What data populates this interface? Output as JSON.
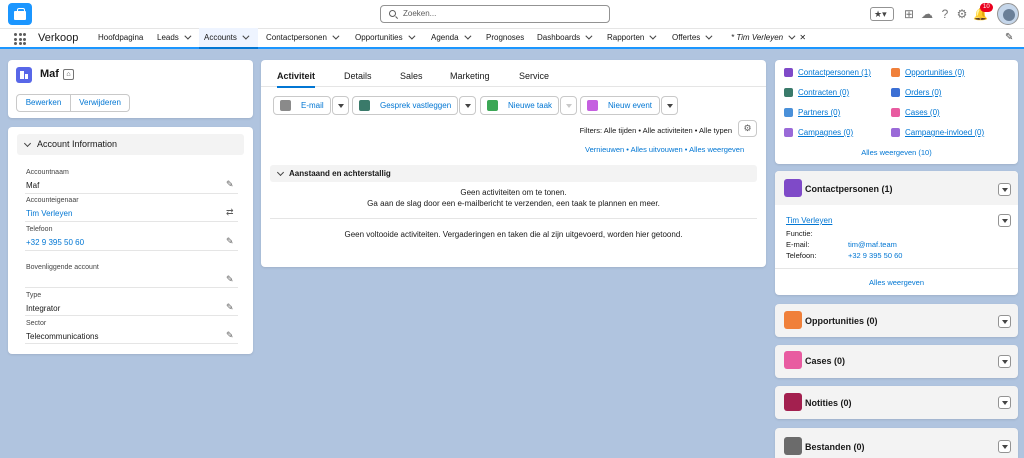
{
  "topbar": {
    "search_placeholder": "Zoeken...",
    "notification_count": "10",
    "icons": [
      "favorites-star-icon",
      "add-icon",
      "trailhead-icon",
      "help-icon",
      "setup-gear-icon",
      "bell-icon",
      "avatar"
    ]
  },
  "nav": {
    "app_name": "Verkoop",
    "items": [
      {
        "label": "Hoofdpagina",
        "dropdown": false
      },
      {
        "label": "Leads",
        "dropdown": true
      },
      {
        "label": "Accounts",
        "dropdown": true,
        "active": true
      },
      {
        "label": "Contactpersonen",
        "dropdown": true
      },
      {
        "label": "Opportunities",
        "dropdown": true
      },
      {
        "label": "Agenda",
        "dropdown": true
      },
      {
        "label": "Prognoses",
        "dropdown": false
      },
      {
        "label": "Dashboards",
        "dropdown": true
      },
      {
        "label": "Rapporten",
        "dropdown": true
      },
      {
        "label": "Offertes",
        "dropdown": true
      }
    ],
    "record_tab": "* Tim Verleyen",
    "close": "✕"
  },
  "account": {
    "name": "Maf",
    "edit_label": "Bewerken",
    "delete_label": "Verwijderen"
  },
  "account_info": {
    "section_title": "Account Information",
    "fields": [
      {
        "label": "Accountnaam",
        "value": "Maf"
      },
      {
        "label": "Accounteigenaar",
        "value": "Tim Verleyen"
      },
      {
        "label": "Telefoon",
        "value": "+32 9 395 50 60"
      },
      {
        "label": "Bovenliggende account",
        "value": ""
      },
      {
        "label": "Type",
        "value": "Integrator"
      },
      {
        "label": "Sector",
        "value": "Telecommunications"
      }
    ]
  },
  "activity": {
    "tabs": [
      "Activiteit",
      "Details",
      "Sales",
      "Marketing",
      "Service"
    ],
    "actions": {
      "email": "E-mail",
      "log_call": "Gesprek vastleggen",
      "new_task": "Nieuwe taak",
      "new_event": "Nieuw event"
    },
    "filters": "Filters: Alle tijden • Alle activiteiten • Alle typen",
    "refresh": "Vernieuwen",
    "expand_all": "Alles uitvouwen",
    "show_all": "Alles weergeven",
    "upcoming_title": "Aanstaand en achterstallig",
    "no_activities": "Geen activiteiten om te tonen.",
    "no_activities_hint": "Ga aan de slag door een e-mailbericht te verzenden, een taak te plannen en meer.",
    "no_past": "Geen voltooide activiteiten. Vergaderingen en taken die al zijn uitgevoerd, worden hier getoond."
  },
  "related_links": {
    "left": [
      {
        "label": "Contactpersonen (1)",
        "color": "#7f4ac8"
      },
      {
        "label": "Contracten (0)",
        "color": "#3a7a6a"
      },
      {
        "label": "Partners (0)",
        "color": "#4a90d9"
      },
      {
        "label": "Campagnes (0)",
        "color": "#9a6ad8"
      }
    ],
    "right": [
      {
        "label": "Opportunities (0)",
        "color": "#f0803a"
      },
      {
        "label": "Orders (0)",
        "color": "#3b6fd4"
      },
      {
        "label": "Cases (0)",
        "color": "#e85ba0"
      },
      {
        "label": "Campagne-invloed (0)",
        "color": "#9a6ad8"
      }
    ],
    "show_all": "Alles weergeven (10)"
  },
  "contacts": {
    "title": "Contactpersonen (1)",
    "name": "Tim Verleyen",
    "function_label": "Functie:",
    "email_label": "E-mail:",
    "email": "tim@maf.team",
    "phone_label": "Telefoon:",
    "phone": "+32 9 395 50 60",
    "show_all": "Alles weergeven"
  },
  "related_cards": [
    {
      "title": "Opportunities (0)",
      "color": "#f0803a"
    },
    {
      "title": "Cases (0)",
      "color": "#e85ba0"
    },
    {
      "title": "Notities (0)",
      "color": "#a3204f"
    },
    {
      "title": "Bestanden (0)",
      "color": "#6b6b6b"
    }
  ],
  "colors": {
    "brand": "#0176d3",
    "background": "#b0c4df",
    "account_icon": "#5867e8"
  }
}
